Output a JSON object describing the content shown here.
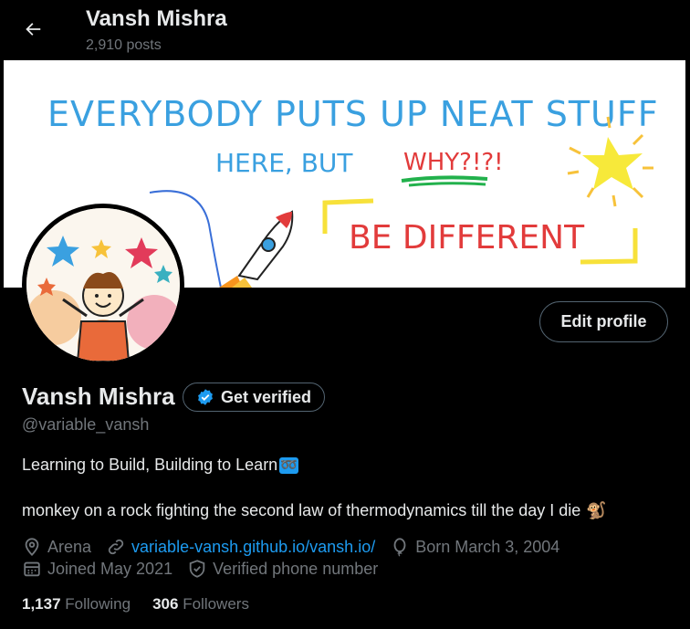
{
  "header": {
    "title": "Vansh Mishra",
    "post_count": "2,910 posts"
  },
  "banner": {
    "line1": "EVERYBODY PUTS UP NEAT STUFF",
    "line2a": "HERE, BUT",
    "line2b": "WHY?!?!",
    "line3": "BE DIFFERENT"
  },
  "profile": {
    "name": "Vansh Mishra",
    "verify_label": "Get verified",
    "handle": "@variable_vansh",
    "edit_label": "Edit profile",
    "bio_line1": "Learning to Build, Building to Learn",
    "bio_line1_emoji": "➿",
    "bio_line2": "monkey on a rock fighting the second law of thermodynamics till the day I die",
    "bio_line2_emoji": "🐒"
  },
  "meta": {
    "location": "Arena",
    "website": "variable-vansh.github.io/vansh.io/",
    "birthday": "Born March 3, 2004",
    "joined": "Joined May 2021",
    "verified_phone": "Verified phone number"
  },
  "stats": {
    "following_count": "1,137",
    "following_label": "Following",
    "followers_count": "306",
    "followers_label": "Followers"
  },
  "colors": {
    "accent": "#1d9bf0",
    "muted": "#71767b",
    "text": "#e7e9ea",
    "border": "#536471"
  }
}
